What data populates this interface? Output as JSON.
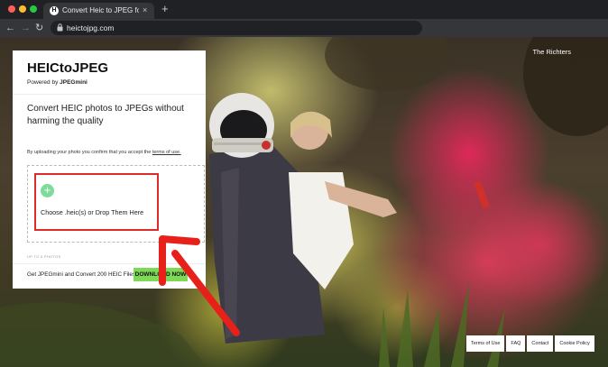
{
  "browser": {
    "tab_favicon": "H",
    "tab_title": "Convert Heic to JPEG for free",
    "tab_close": "×",
    "new_tab": "+",
    "url": "heictojpg.com",
    "nav_back": "←",
    "nav_forward": "→",
    "nav_reload": "↻",
    "bookmark_star": "☆"
  },
  "page": {
    "photo_credit": "The Richters",
    "card": {
      "brand": "HEICtoJPEG",
      "powered_prefix": "Powered by ",
      "powered_brand": "JPEGmini",
      "headline": "Convert HEIC photos to JPEGs without harming the quality",
      "terms_prefix": "By uploading your photo you confirm that you accept the ",
      "terms_link": "terms of use.",
      "upload_plus": "+",
      "upload_label": "Choose .heic(s) or Drop Them Here",
      "limit_note": "UP TO 5 PHOTOS",
      "promo_text": "Get JPEGmini and Convert 200 HEIC Files",
      "download_label": "DOWNLOAD NOW"
    },
    "footer_links": [
      "Terms of Use",
      "FAQ",
      "Contact",
      "Cookie Policy"
    ]
  },
  "colors": {
    "highlight_border": "#dd2b2b",
    "arrow": "#e8201a",
    "download_button": "#7ed957",
    "plus_circle": "#7ddc9a"
  }
}
